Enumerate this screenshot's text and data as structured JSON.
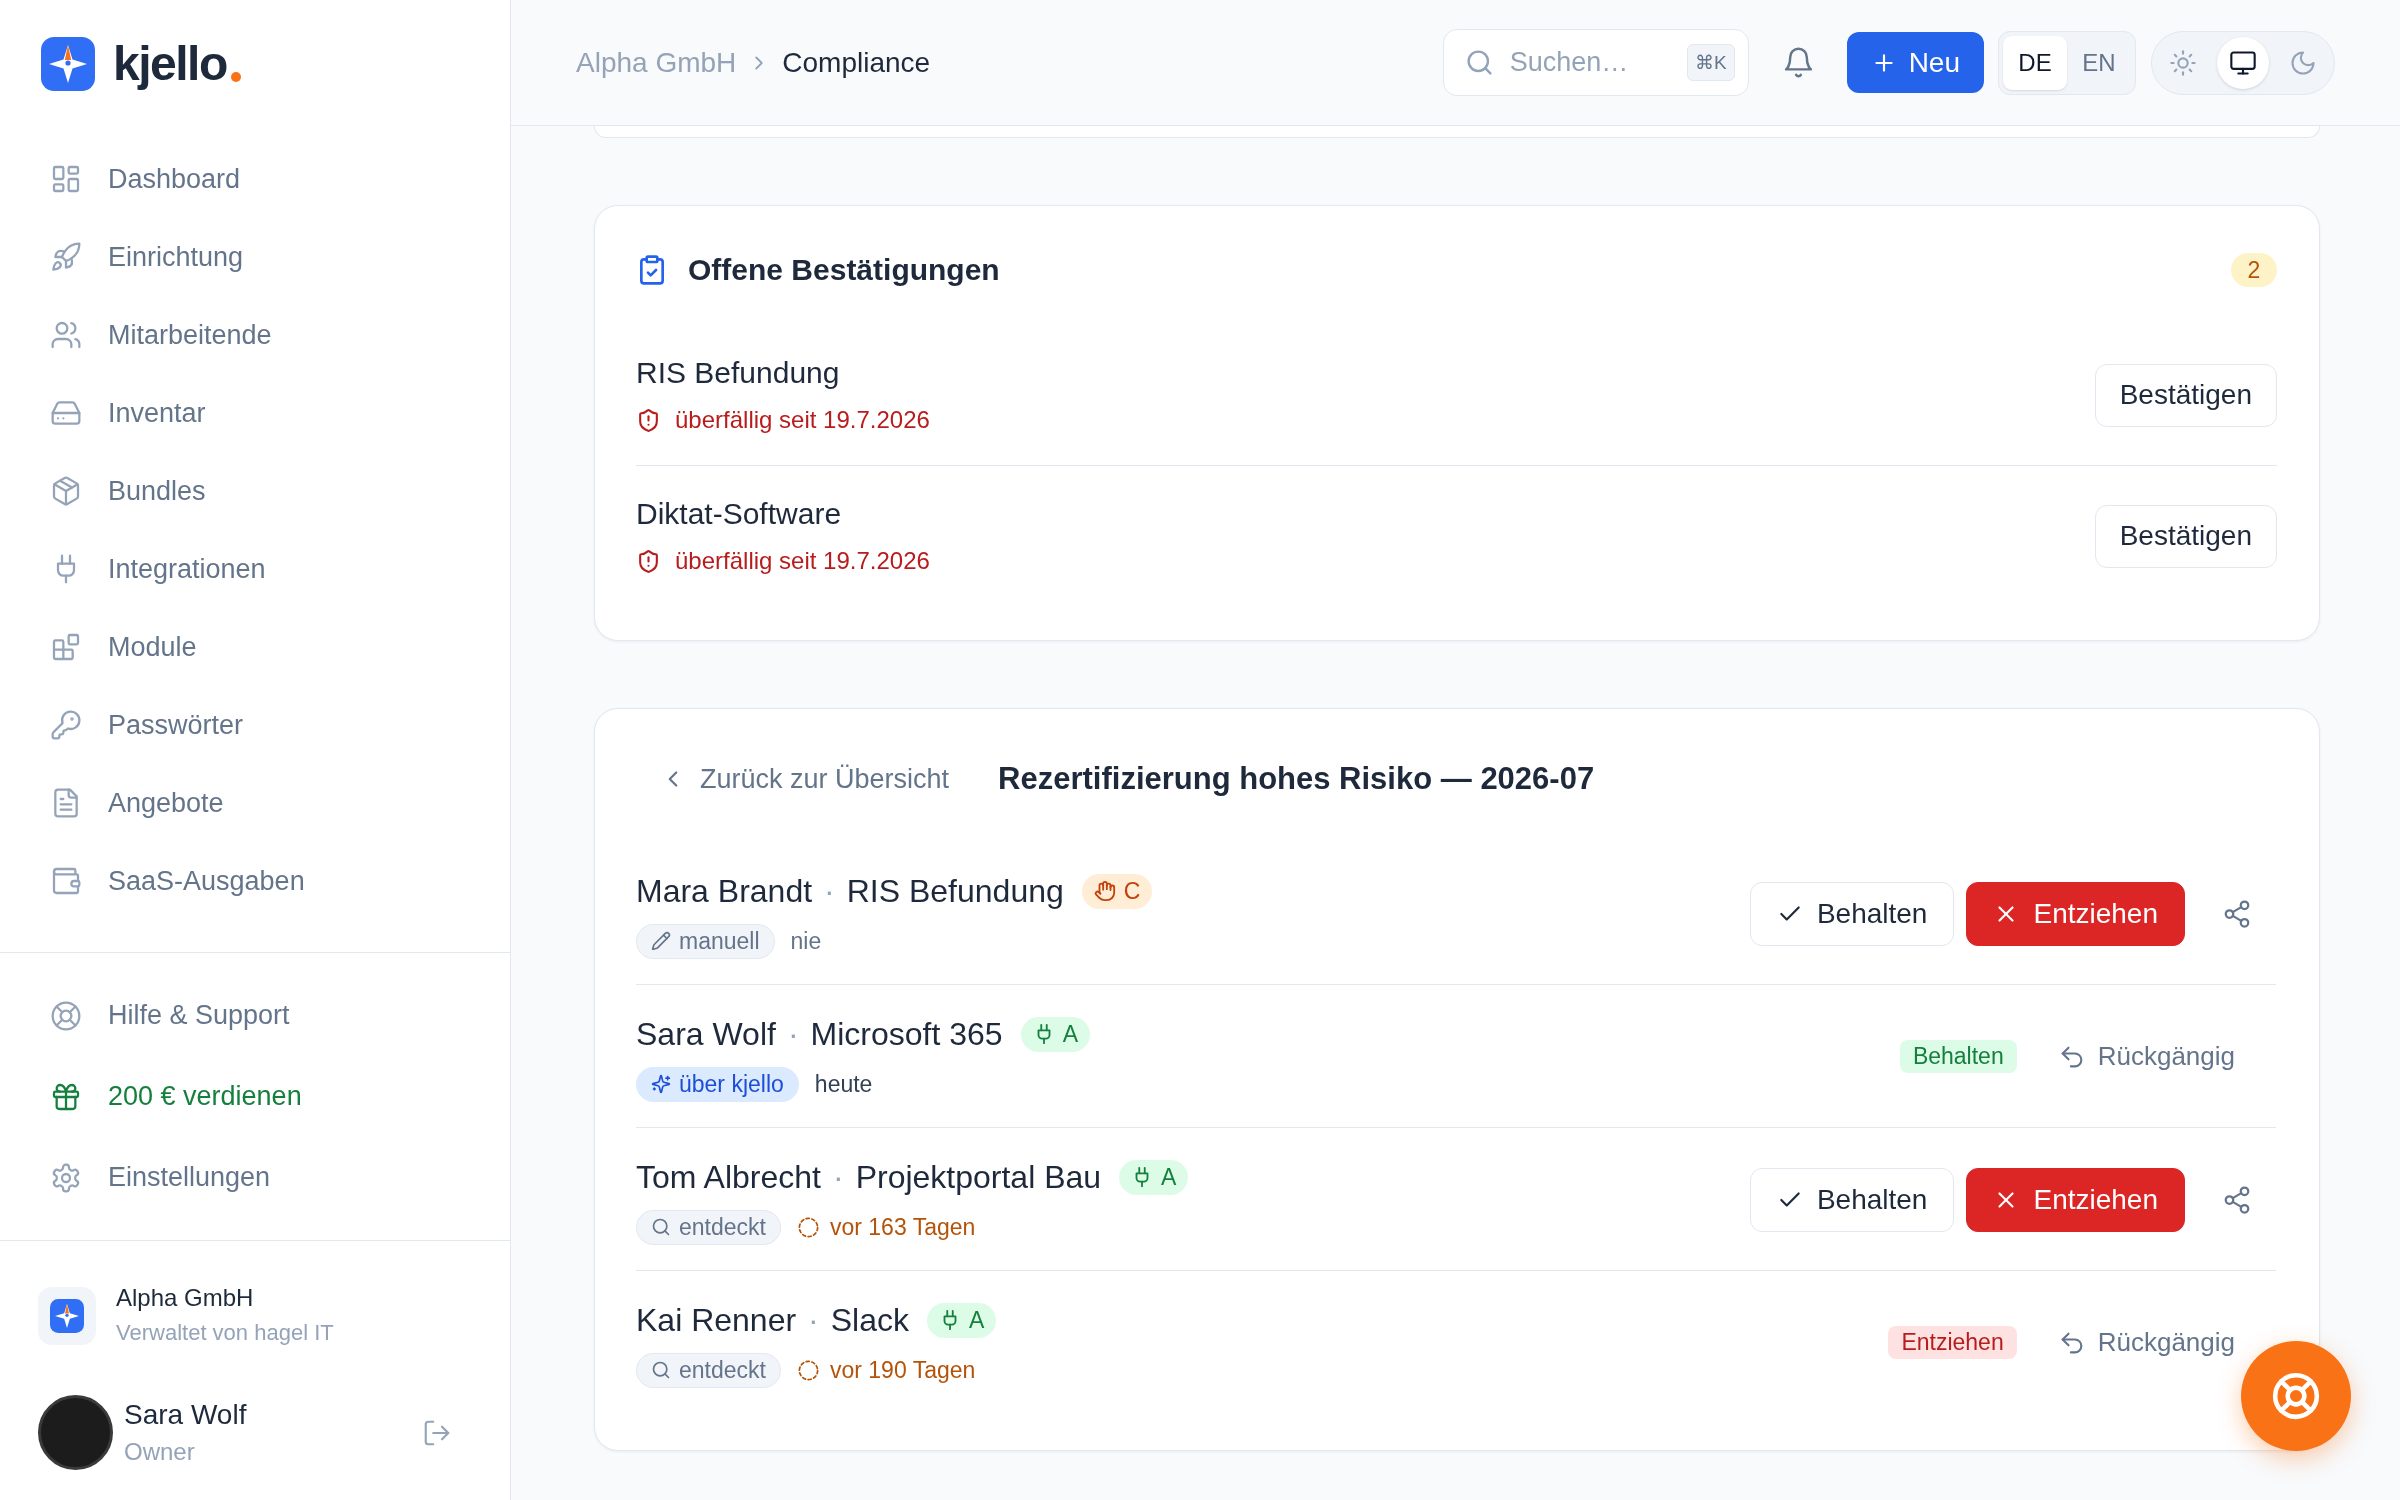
{
  "sidebar": {
    "brand": "kjello",
    "nav_items": [
      {
        "label": "Dashboard"
      },
      {
        "label": "Einrichtung"
      },
      {
        "label": "Mitarbeitende"
      },
      {
        "label": "Inventar"
      },
      {
        "label": "Bundles"
      },
      {
        "label": "Integrationen"
      },
      {
        "label": "Module"
      },
      {
        "label": "Passwörter"
      },
      {
        "label": "Angebote"
      },
      {
        "label": "SaaS-Ausgaben"
      }
    ],
    "footer_items": [
      {
        "label": "Hilfe & Support",
        "kind": "link"
      },
      {
        "label": "200 € verdienen",
        "kind": "promo"
      },
      {
        "label": "Einstellungen",
        "kind": "link"
      }
    ],
    "organization": {
      "name": "Alpha GmbH",
      "subtitle": "Verwaltet von hagel IT"
    },
    "user": {
      "name": "Sara Wolf",
      "role": "Owner"
    }
  },
  "header": {
    "breadcrumb": [
      {
        "label": "Alpha GmbH",
        "current": false
      },
      {
        "label": "Compliance",
        "current": true
      }
    ],
    "search": {
      "placeholder": "Suchen…",
      "shortcut": "⌘K"
    },
    "new_button": "Neu",
    "languages": [
      {
        "label": "DE",
        "selected": true
      },
      {
        "label": "EN",
        "selected": false
      }
    ],
    "themes": [
      {
        "kind": "light",
        "selected": false
      },
      {
        "kind": "system",
        "selected": true
      },
      {
        "kind": "dark",
        "selected": false
      }
    ]
  },
  "pending_confirmations": {
    "title": "Offene Bestätigungen",
    "count": "2",
    "items": [
      {
        "name": "RIS Befundung",
        "status": {
          "kind": "overdue",
          "text": "überfällig seit 19.7.2026"
        },
        "button": "Bestätigen"
      },
      {
        "name": "Diktat-Software",
        "status": {
          "kind": "overdue",
          "text": "überfällig seit 19.7.2026"
        },
        "button": "Bestätigen"
      }
    ]
  },
  "recertification": {
    "back_link": "Zurück zur Übersicht",
    "title": "Rezertifizierung hohes Risiko — 2026-07",
    "rows": [
      {
        "person": "Mara Brandt",
        "separator": "·",
        "app": "RIS Befundung",
        "tag": {
          "kind": "manual",
          "label": "C"
        },
        "source": {
          "kind": "manual",
          "label": "manuell"
        },
        "last_seen": {
          "kind": "never",
          "text": "nie"
        },
        "actions": [
          {
            "kind": "keep",
            "label": "Behalten"
          },
          {
            "kind": "revoke",
            "label": "Entziehen"
          }
        ]
      },
      {
        "person": "Sara Wolf",
        "separator": "·",
        "app": "Microsoft 365",
        "tag": {
          "kind": "integration",
          "label": "A"
        },
        "source": {
          "kind": "kjello",
          "label": "über kjello"
        },
        "last_seen": {
          "kind": "recent",
          "text": "heute"
        },
        "status": {
          "kind": "keep",
          "label": "Behalten"
        },
        "undo": "Rückgängig"
      },
      {
        "person": "Tom Albrecht",
        "separator": "·",
        "app": "Projektportal Bau",
        "tag": {
          "kind": "integration",
          "label": "A"
        },
        "source": {
          "kind": "discovered",
          "label": "entdeckt"
        },
        "last_seen": {
          "kind": "stale",
          "text": "vor 163 Tagen"
        },
        "actions": [
          {
            "kind": "keep",
            "label": "Behalten"
          },
          {
            "kind": "revoke",
            "label": "Entziehen"
          }
        ]
      },
      {
        "person": "Kai Renner",
        "separator": "·",
        "app": "Slack",
        "tag": {
          "kind": "integration",
          "label": "A"
        },
        "source": {
          "kind": "discovered",
          "label": "entdeckt"
        },
        "last_seen": {
          "kind": "stale",
          "text": "vor 190 Tagen"
        },
        "status": {
          "kind": "revoke",
          "label": "Entziehen"
        },
        "undo": "Rückgängig"
      }
    ]
  }
}
